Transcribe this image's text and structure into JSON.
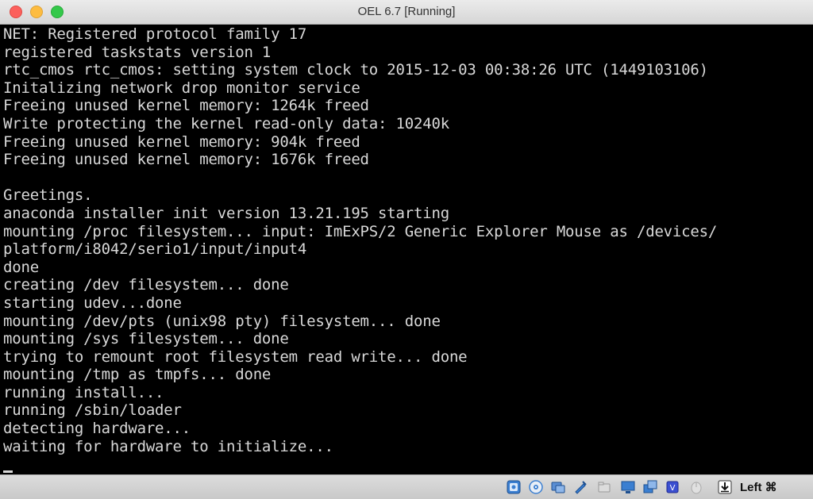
{
  "window": {
    "title": "OEL 6.7 [Running]"
  },
  "console": {
    "lines": [
      "NET: Registered protocol family 17",
      "registered taskstats version 1",
      "rtc_cmos rtc_cmos: setting system clock to 2015-12-03 00:38:26 UTC (1449103106)",
      "Initalizing network drop monitor service",
      "Freeing unused kernel memory: 1264k freed",
      "Write protecting the kernel read-only data: 10240k",
      "Freeing unused kernel memory: 904k freed",
      "Freeing unused kernel memory: 1676k freed",
      "",
      "Greetings.",
      "anaconda installer init version 13.21.195 starting",
      "mounting /proc filesystem... input: ImExPS/2 Generic Explorer Mouse as /devices/",
      "platform/i8042/serio1/input/input4",
      "done",
      "creating /dev filesystem... done",
      "starting udev...done",
      "mounting /dev/pts (unix98 pty) filesystem... done",
      "mounting /sys filesystem... done",
      "trying to remount root filesystem read write... done",
      "mounting /tmp as tmpfs... done",
      "running install...",
      "running /sbin/loader",
      "detecting hardware...",
      "waiting for hardware to initialize..."
    ]
  },
  "statusbar": {
    "icons": [
      "hard-disk-icon",
      "optical-drive-icon",
      "audio-icon",
      "network-icon",
      "usb-icon",
      "shared-folder-icon",
      "display-icon",
      "video-capture-icon",
      "cpu-virtualization-icon",
      "mouse-integration-icon",
      "keyboard-capture-icon"
    ],
    "host_key_label": "Left ⌘"
  }
}
